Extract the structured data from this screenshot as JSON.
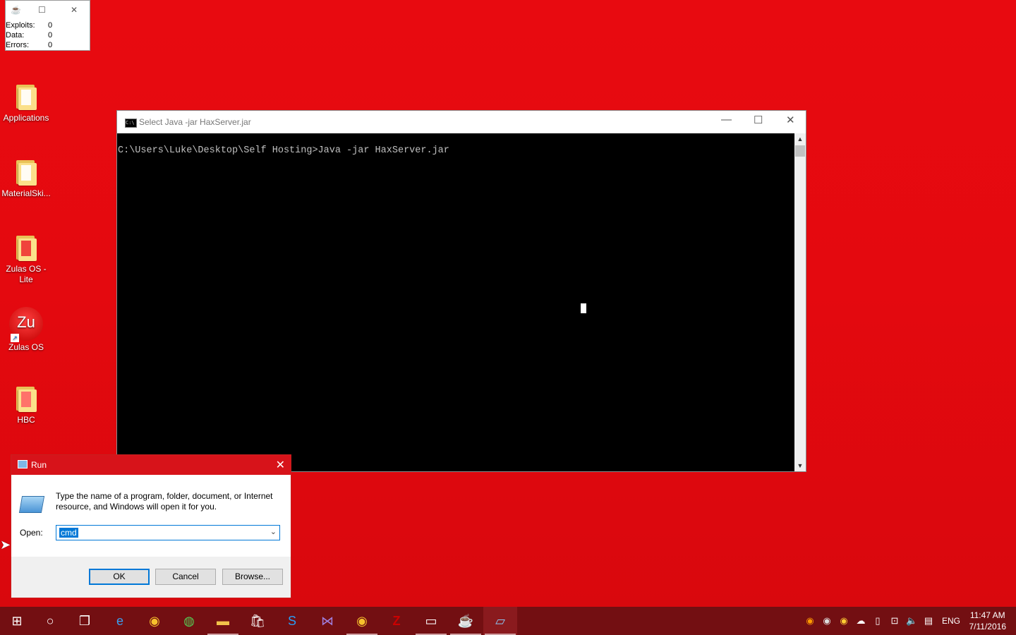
{
  "stats_window": {
    "rows": [
      {
        "label": "Exploits:",
        "value": "0"
      },
      {
        "label": "Data:",
        "value": "0"
      },
      {
        "label": "Errors:",
        "value": "0"
      }
    ]
  },
  "desktop_icons": [
    {
      "label": "Applications"
    },
    {
      "label": "MaterialSki..."
    },
    {
      "label": "Zulas OS - Lite"
    },
    {
      "label": "Zulas OS",
      "glyph": "Zu"
    },
    {
      "label": "HBC"
    }
  ],
  "cmd_window": {
    "title": "Select Java  -jar HaxServer.jar",
    "prompt_line": "C:\\Users\\Luke\\Desktop\\Self Hosting>Java -jar HaxServer.jar"
  },
  "run_dialog": {
    "title": "Run",
    "description": "Type the name of a program, folder, document, or Internet resource, and Windows will open it for you.",
    "open_label": "Open:",
    "open_value": "cmd",
    "ok_label": "OK",
    "cancel_label": "Cancel",
    "browse_label": "Browse..."
  },
  "taskbar": {
    "apps": [
      "start",
      "cortana",
      "task-view",
      "edge",
      "chrome",
      "globe",
      "file-explorer",
      "store",
      "skype",
      "visual-studio",
      "chrome-alt",
      "filezilla",
      "cmd",
      "java",
      "run"
    ],
    "language": "ENG",
    "time": "11:47 AM",
    "date": "7/11/2016"
  },
  "colors": {
    "desktop": "#e80a10",
    "taskbar": "#730f12",
    "run_titlebar": "#d7131a",
    "accent": "#0078d7"
  }
}
